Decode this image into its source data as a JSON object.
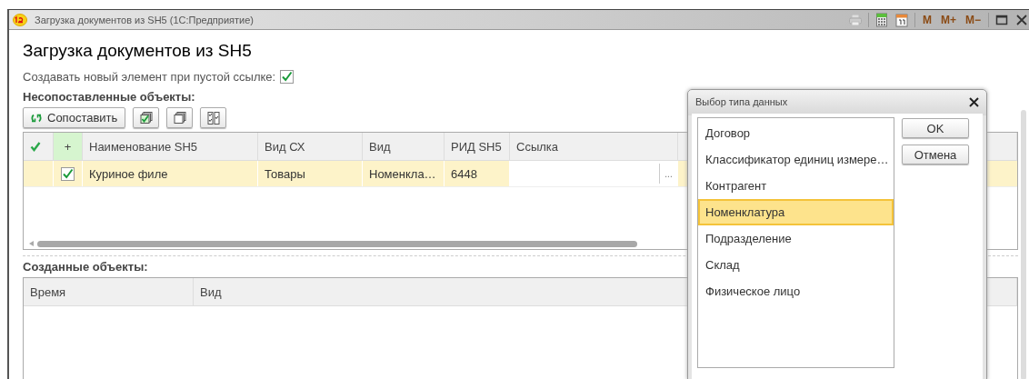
{
  "window": {
    "title": "Загрузка документов из SH5  (1С:Предприятие)",
    "tools": [
      "M",
      "M+",
      "M−"
    ]
  },
  "form_title": "Загрузка документов из SH5",
  "option": {
    "label": "Создавать новый элемент при пустой ссылке:",
    "checked": true
  },
  "unmatched": {
    "title": "Несопоставленные объекты:",
    "match_button": "Сопоставить",
    "columns": [
      {
        "kind": "icon"
      },
      {
        "kind": "text",
        "label": "+",
        "highlight": true
      },
      {
        "kind": "text",
        "label": "Наименование SH5"
      },
      {
        "kind": "text",
        "label": "Вид СХ"
      },
      {
        "kind": "text",
        "label": "Вид"
      },
      {
        "kind": "text",
        "label": "РИД SH5"
      },
      {
        "kind": "text",
        "label": "Ссылка"
      }
    ],
    "rows": [
      {
        "selected": true,
        "checked": true,
        "name": "Куриное филе",
        "vid_cx": "Товары",
        "vid": "Номенкла…",
        "rid": "6448",
        "choose_button": "..."
      }
    ]
  },
  "created": {
    "title": "Созданные объекты:",
    "columns": [
      "Время",
      "Вид"
    ]
  },
  "dialog": {
    "title": "Выбор типа данных",
    "items": [
      {
        "label": "Договор",
        "selected": false
      },
      {
        "label": "Классификатор единиц измере…",
        "selected": false
      },
      {
        "label": "Контрагент",
        "selected": false
      },
      {
        "label": "Номенклатура",
        "selected": true
      },
      {
        "label": "Подразделение",
        "selected": false
      },
      {
        "label": "Склад",
        "selected": false
      },
      {
        "label": "Физическое лицо",
        "selected": false
      }
    ],
    "buttons": [
      "OK",
      "Отмена"
    ]
  }
}
